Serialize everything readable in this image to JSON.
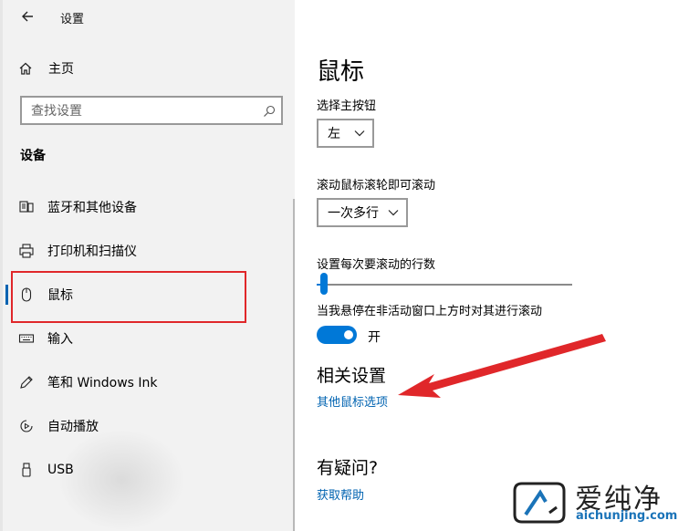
{
  "window": {
    "title": "设置"
  },
  "sidebar": {
    "home_label": "主页",
    "search_placeholder": "查找设置",
    "section_title": "设备",
    "items": [
      {
        "label": "蓝牙和其他设备",
        "icon": "bluetooth-devices-icon"
      },
      {
        "label": "打印机和扫描仪",
        "icon": "printer-icon"
      },
      {
        "label": "鼠标",
        "icon": "mouse-icon",
        "selected": true
      },
      {
        "label": "输入",
        "icon": "keyboard-icon"
      },
      {
        "label": "笔和 Windows Ink",
        "icon": "pen-icon"
      },
      {
        "label": "自动播放",
        "icon": "autoplay-icon"
      },
      {
        "label": "USB",
        "icon": "usb-icon"
      }
    ]
  },
  "main": {
    "title": "鼠标",
    "primary_button": {
      "label": "选择主按钮",
      "value": "左"
    },
    "scroll_mode": {
      "label": "滚动鼠标滚轮即可滚动",
      "value": "一次多行"
    },
    "scroll_lines": {
      "label": "设置每次要滚动的行数",
      "level_percent": 3
    },
    "inactive_scroll": {
      "label": "当我悬停在非活动窗口上方时对其进行滚动",
      "state": "开",
      "on": true
    },
    "related": {
      "title": "相关设置",
      "link": "其他鼠标选项"
    },
    "help": {
      "title": "有疑问?",
      "link": "获取帮助"
    }
  },
  "watermark": {
    "brand": "爱纯净",
    "url": "aichunjing.com"
  },
  "colors": {
    "accent": "#0078d7",
    "link": "#0063b1",
    "annotation": "#e0272a"
  }
}
